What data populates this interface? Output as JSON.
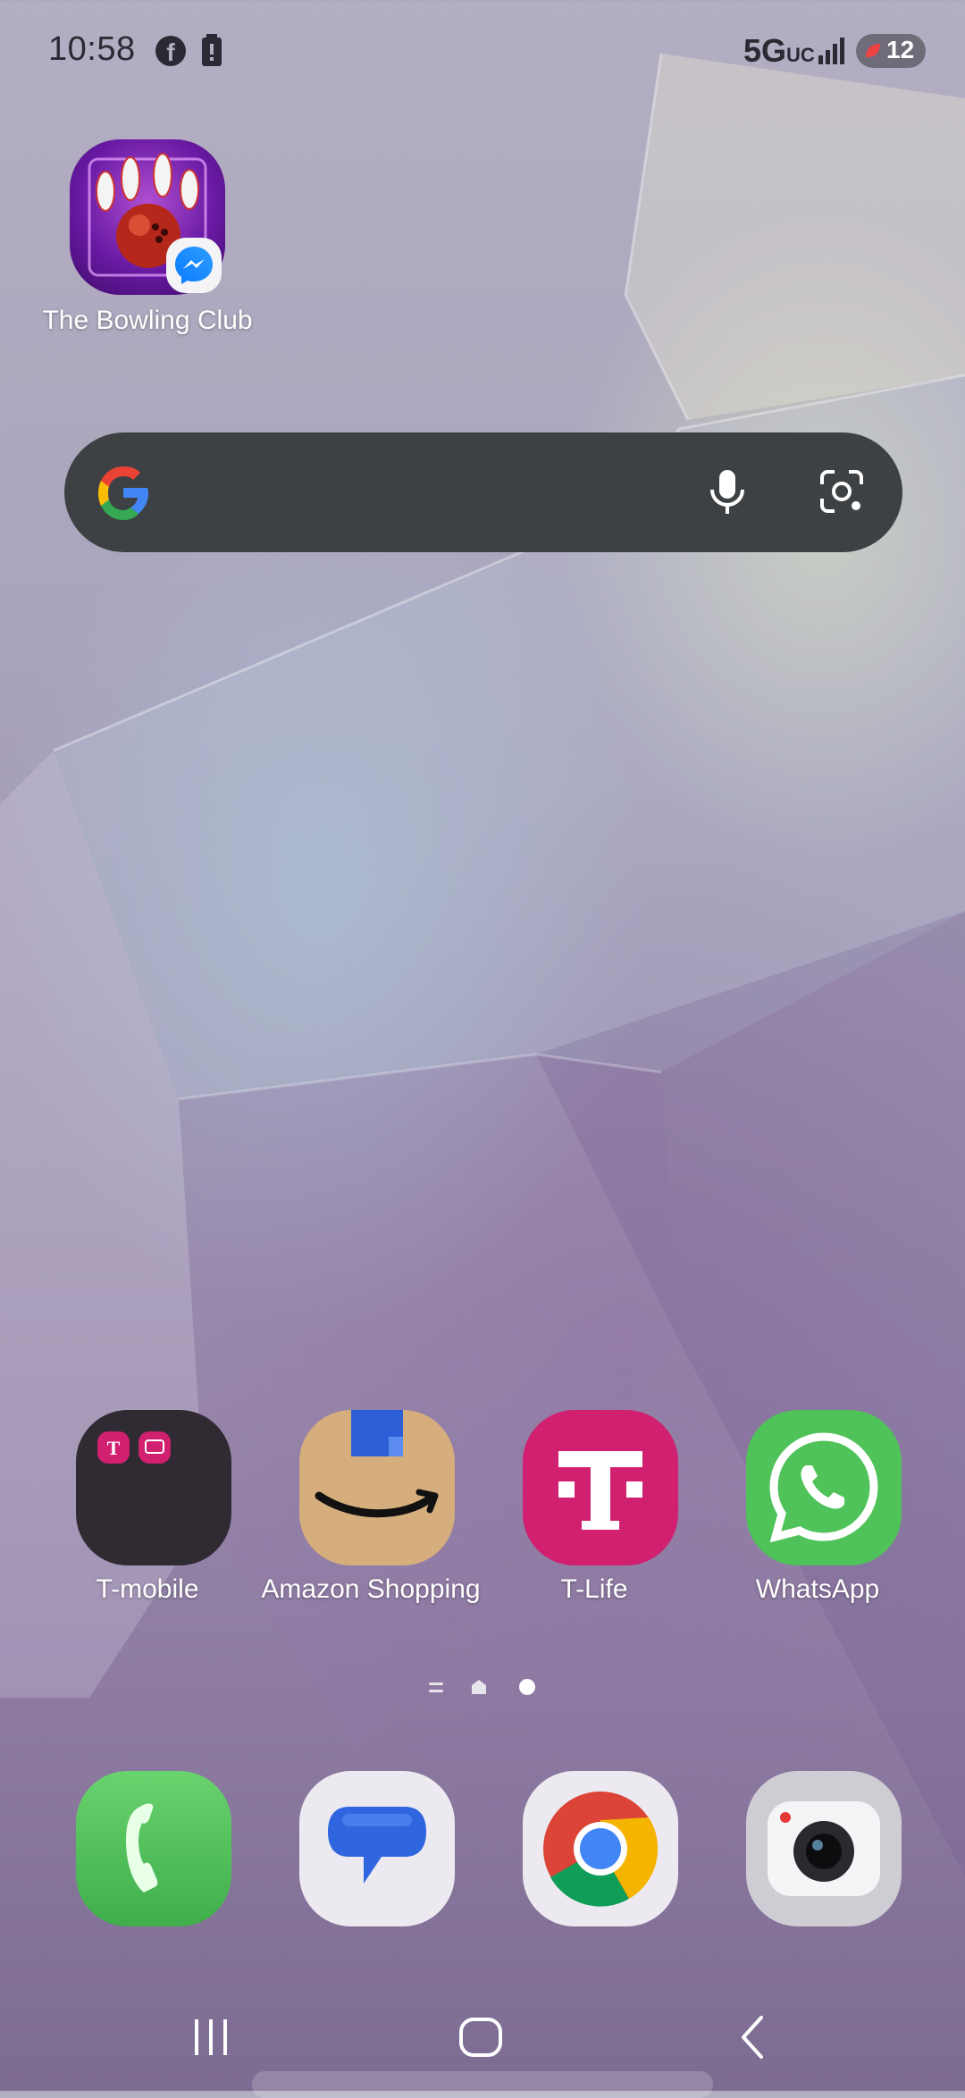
{
  "status_bar": {
    "time": "10:58",
    "network": "5G",
    "network_sub": "UC",
    "battery": "12"
  },
  "home": {
    "top_app": {
      "label": "The Bowling Club",
      "icon": "bowling-game-icon",
      "badge": "messenger-icon"
    },
    "search": {
      "icons": [
        "google-logo-icon",
        "microphone-icon",
        "google-lens-icon"
      ]
    },
    "row_apps": [
      {
        "label": "T-mobile",
        "icon": "folder-icon"
      },
      {
        "label": "Amazon Shopping",
        "icon": "amazon-icon"
      },
      {
        "label": "T-Life",
        "icon": "t-life-icon"
      },
      {
        "label": "WhatsApp",
        "icon": "whatsapp-icon"
      }
    ],
    "dock_apps": [
      {
        "name": "Phone",
        "icon": "phone-icon"
      },
      {
        "name": "Messages",
        "icon": "messages-icon"
      },
      {
        "name": "Chrome",
        "icon": "chrome-icon"
      },
      {
        "name": "Camera",
        "icon": "camera-icon"
      }
    ],
    "page_indicator": {
      "pages": 3,
      "current": 3
    }
  },
  "colors": {
    "search_bg": "#3e4143",
    "tmobile_magenta": "#d0206f",
    "whatsapp_green": "#4fc35a",
    "amazon_tan": "#d6ad7c"
  }
}
